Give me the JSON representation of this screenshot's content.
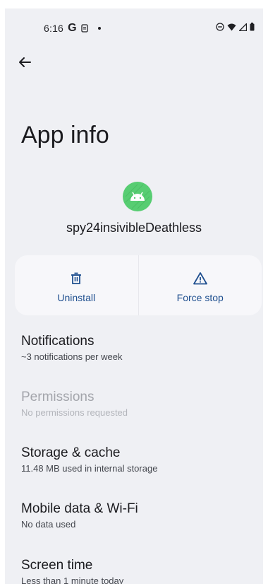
{
  "status_bar": {
    "time": "6:16",
    "left_icons": [
      "google-g-icon",
      "sim-icon",
      "dot-icon"
    ],
    "right_icons": [
      "dnd-icon",
      "wifi-icon",
      "signal-icon",
      "battery-icon"
    ]
  },
  "page": {
    "title": "App info"
  },
  "app": {
    "name": "spy24insivibleDeathless",
    "icon": "android-icon",
    "icon_color": "#57cd72"
  },
  "actions": {
    "uninstall_label": "Uninstall",
    "force_stop_label": "Force stop",
    "accent": "#1f4f8f"
  },
  "settings": {
    "notifications": {
      "title": "Notifications",
      "subtitle": "~3 notifications per week"
    },
    "permissions": {
      "title": "Permissions",
      "subtitle": "No permissions requested"
    },
    "storage": {
      "title": "Storage & cache",
      "subtitle": "11.48 MB used in internal storage"
    },
    "mobile_data": {
      "title": "Mobile data & Wi-Fi",
      "subtitle": "No data used"
    },
    "screen_time": {
      "title": "Screen time",
      "subtitle": "Less than 1 minute today"
    }
  }
}
